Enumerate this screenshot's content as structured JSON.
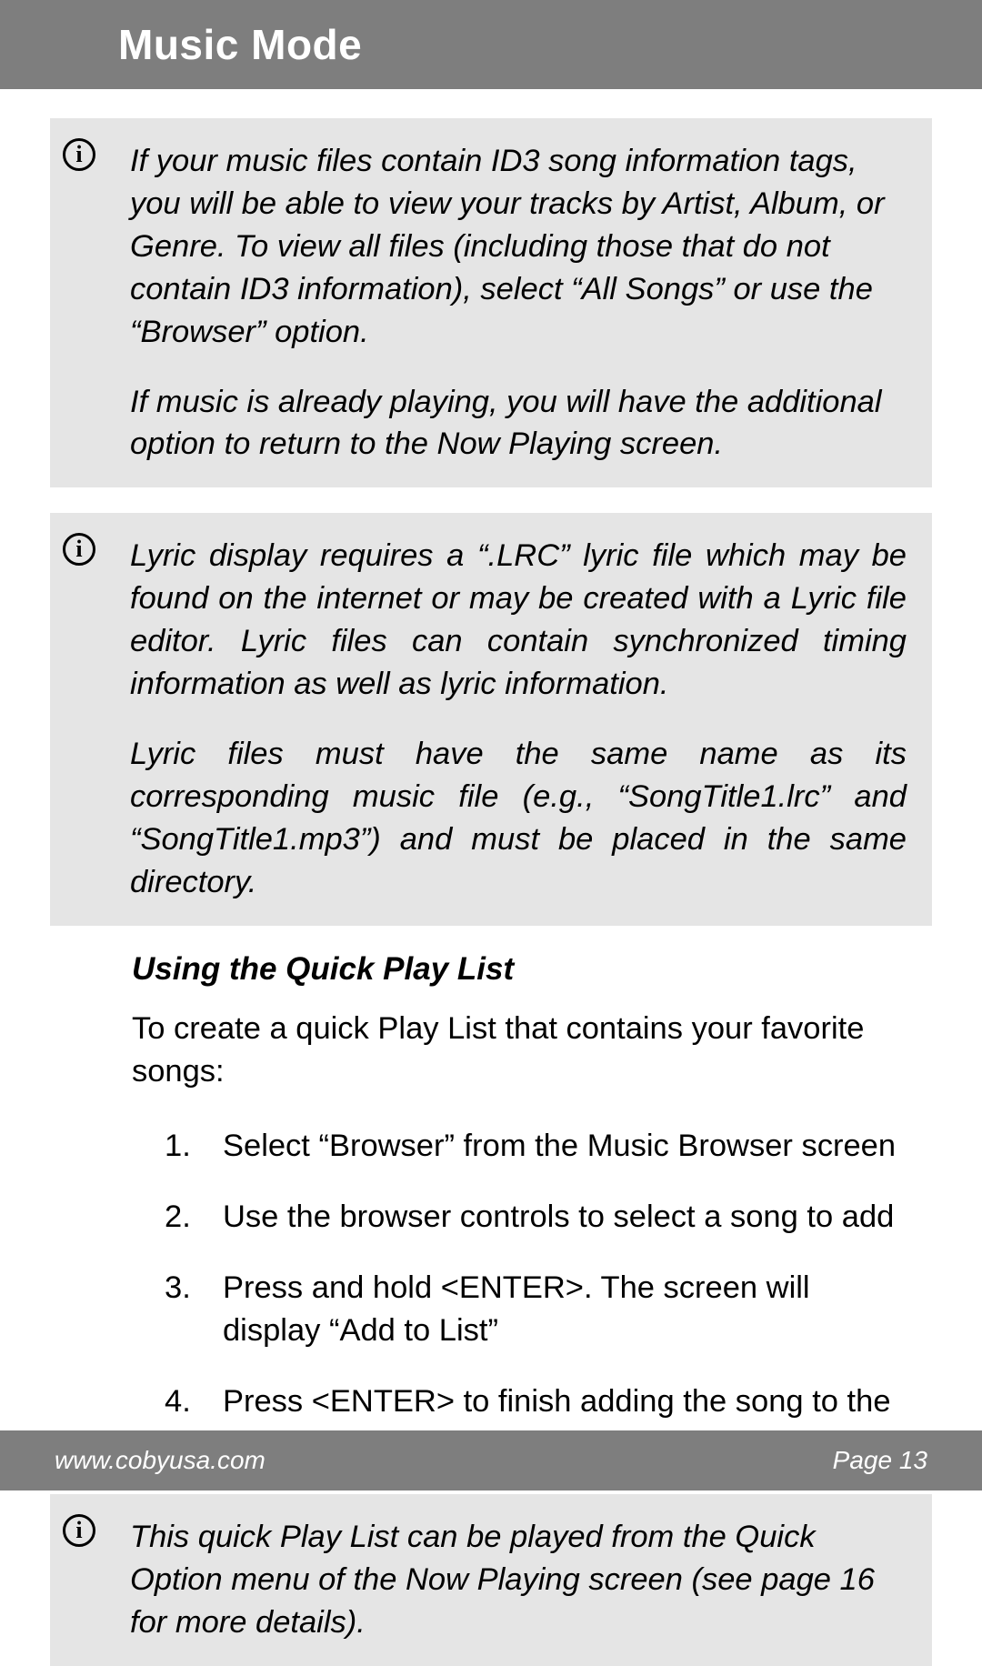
{
  "header": {
    "title": "Music Mode"
  },
  "info1": {
    "p1": "If your music files contain ID3 song information tags, you will be able to view your tracks by Artist, Album, or Genre. To view all files (including those that do not contain ID3 information), select “All Songs” or use the “Browser” option.",
    "p2": "If music is already playing, you will have the additional option to return to the Now Playing screen."
  },
  "info2": {
    "p1": "Lyric display requires a “.LRC” lyric file which may be found on the internet or may be created with a Lyric file editor. Lyric files can contain synchronized timing information as well as lyric information.",
    "p2": "Lyric files must have the same name as its corresponding music file (e.g., “SongTitle1.lrc” and “SongTitle1.mp3”) and must be placed in the same directory."
  },
  "quickplay": {
    "title": "Using the Quick Play List",
    "intro": "To create a quick Play List that contains your favorite songs:",
    "steps": [
      "Select “Browser” from the Music Browser screen",
      "Use the browser controls to select a song to add",
      "Press and hold <ENTER>. The screen will display “Add to List”",
      "Press <ENTER> to finish adding the song to the Play List"
    ]
  },
  "info3": {
    "p1": "This quick Play List can be played from the Quick Option menu of the Now Playing screen (see page 16 for more details)."
  },
  "footer": {
    "url": "www.cobyusa.com",
    "page": "Page 13"
  }
}
